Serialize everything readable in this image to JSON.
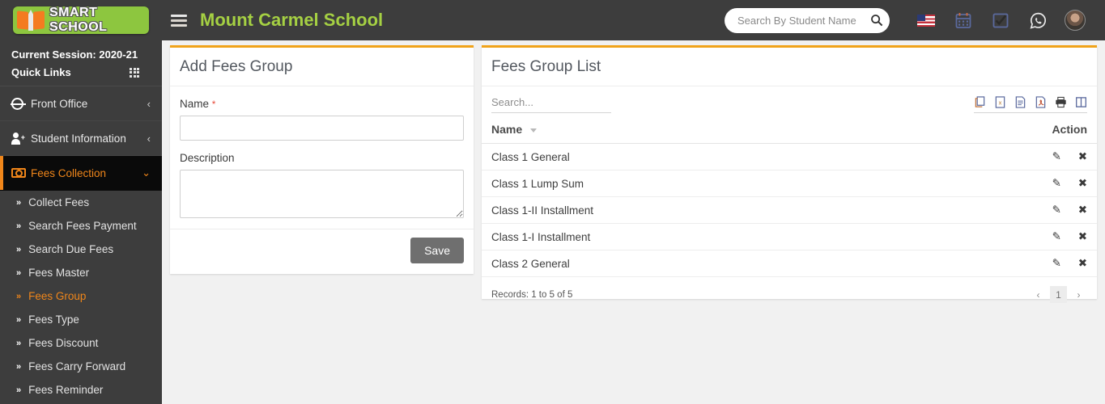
{
  "topbar": {
    "logo_text": "SMART SCHOOL",
    "logo_icon": "book-icon",
    "menu_toggle_icon": "hamburger-icon",
    "school_title": "Mount Carmel School",
    "search_placeholder": "Search By Student Name",
    "search_value": "",
    "search_icon": "search-icon",
    "icons": [
      {
        "name": "flag-icon",
        "label": "US"
      },
      {
        "name": "calendar-icon",
        "label": "Calendar"
      },
      {
        "name": "checkbox-task-icon",
        "label": "Tasks"
      },
      {
        "name": "whatsapp-icon",
        "label": "WhatsApp"
      },
      {
        "name": "avatar",
        "label": "Profile"
      }
    ]
  },
  "sidebar": {
    "session_label": "Current Session: 2020-21",
    "quick_links_label": "Quick Links",
    "quick_links_icon": "grid-icon",
    "items": [
      {
        "label": "Front Office",
        "icon": "headset-icon",
        "caret": "‹",
        "active": false
      },
      {
        "label": "Student Information",
        "icon": "user-plus-icon",
        "caret": "‹",
        "active": false
      },
      {
        "label": "Fees Collection",
        "icon": "money-icon",
        "caret": "⌄",
        "active": true
      }
    ],
    "sub_items": [
      {
        "label": "Collect Fees",
        "active": false
      },
      {
        "label": "Search Fees Payment",
        "active": false
      },
      {
        "label": "Search Due Fees",
        "active": false
      },
      {
        "label": "Fees Master",
        "active": false
      },
      {
        "label": "Fees Group",
        "active": true
      },
      {
        "label": "Fees Type",
        "active": false
      },
      {
        "label": "Fees Discount",
        "active": false
      },
      {
        "label": "Fees Carry Forward",
        "active": false
      },
      {
        "label": "Fees Reminder",
        "active": false
      }
    ],
    "sub_chevron": "»"
  },
  "form_card": {
    "title": "Add Fees Group",
    "name_label": "Name",
    "required_mark": "*",
    "name_value": "",
    "name_placeholder": "",
    "description_label": "Description",
    "description_value": "",
    "description_placeholder": "",
    "save_label": "Save"
  },
  "list_card": {
    "title": "Fees Group List",
    "search_placeholder": "Search...",
    "search_value": "",
    "export_icons": [
      {
        "name": "copy-icon",
        "label": "Copy"
      },
      {
        "name": "excel-icon",
        "label": "Excel"
      },
      {
        "name": "csv-icon",
        "label": "CSV"
      },
      {
        "name": "pdf-icon",
        "label": "PDF"
      },
      {
        "name": "print-icon",
        "label": "Print"
      },
      {
        "name": "column-visibility-icon",
        "label": "Columns"
      }
    ],
    "columns": [
      "Name",
      "Action"
    ],
    "sort_column": "Name",
    "sort_direction": "desc",
    "rows": [
      {
        "name": "Class 1 General"
      },
      {
        "name": "Class 1 Lump Sum"
      },
      {
        "name": "Class 1-II Installment"
      },
      {
        "name": "Class 1-I Installment"
      },
      {
        "name": "Class 2 General"
      }
    ],
    "row_actions": [
      {
        "name": "edit-icon",
        "glyph": "✎"
      },
      {
        "name": "delete-icon",
        "glyph": "✖"
      }
    ],
    "records_text": "Records: 1 to 5 of 5",
    "pagination": {
      "prev": "‹",
      "pages": [
        "1"
      ],
      "next": "›",
      "current": "1"
    }
  },
  "colors": {
    "accent_orange": "#f0a31a",
    "sidebar_bg": "#3d3d3d",
    "active_nav_bg": "#0a0a0a",
    "title_green": "#a5d043",
    "logo_green": "#8dc63f",
    "save_grey": "#6f6f6f",
    "page_bg": "#f1f1f1"
  }
}
